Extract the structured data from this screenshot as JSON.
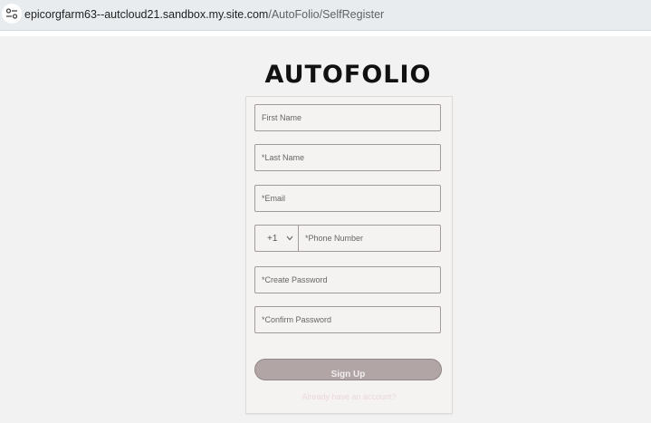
{
  "browser": {
    "url_host": "epicorgfarm63--autcloud21.sandbox.my.site.com",
    "url_path": "/AutoFolio/SelfRegister",
    "site_info_icon": "tune-icon"
  },
  "page": {
    "logo": "AUTOFOLIO"
  },
  "form": {
    "first_name_placeholder": "First Name",
    "last_name_placeholder": "*Last Name",
    "email_placeholder": "*Email",
    "phone_code": "+1",
    "phone_placeholder": "*Phone Number",
    "create_password_placeholder": "*Create Password",
    "confirm_password_placeholder": "*Confirm Password",
    "signup_label": "Sign Up",
    "already_account_link": "Already have an account?"
  },
  "colors": {
    "signup_button": "#b1a5a6",
    "field_border": "#a29a98",
    "card_background": "#f4f3f1",
    "page_background": "#f2f2f2"
  }
}
